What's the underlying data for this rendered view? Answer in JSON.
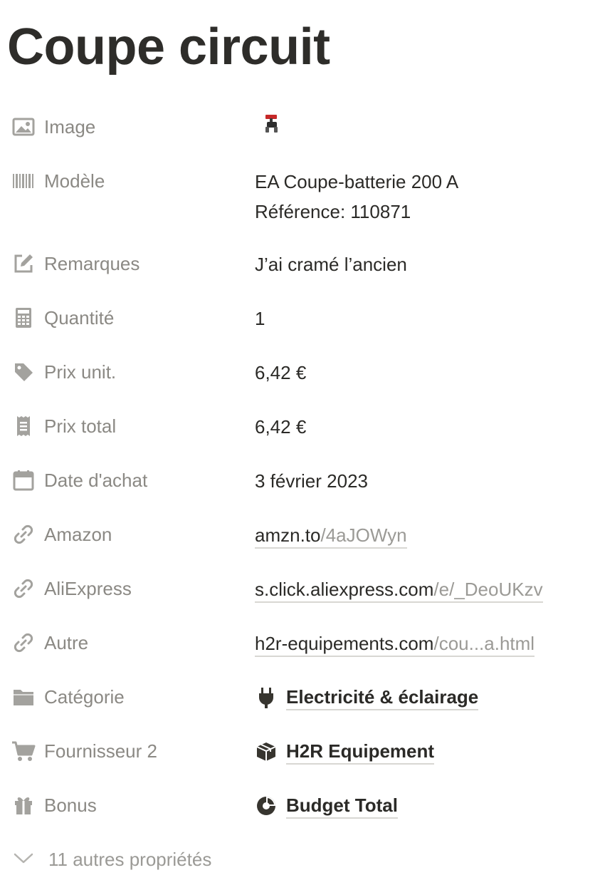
{
  "page": {
    "title": "Coupe circuit"
  },
  "properties": {
    "image": {
      "label": "Image",
      "icon": "image-icon",
      "thumbnail": "red-battery-switch"
    },
    "modele": {
      "label": "Modèle",
      "icon": "barcode-icon",
      "line1": "EA Coupe-batterie 200 A",
      "line2": "Référence: 110871"
    },
    "remarques": {
      "label": "Remarques",
      "icon": "edit-icon",
      "value": "J’ai cramé l’ancien"
    },
    "quantite": {
      "label": "Quantité",
      "icon": "calculator-icon",
      "value": "1"
    },
    "prix_unit": {
      "label": "Prix unit.",
      "icon": "tag-icon",
      "value": "6,42 €"
    },
    "prix_total": {
      "label": "Prix total",
      "icon": "receipt-icon",
      "value": "6,42 €"
    },
    "date_achat": {
      "label": "Date d'achat",
      "icon": "calendar-icon",
      "value": "3 février 2023"
    },
    "amazon": {
      "label": "Amazon",
      "icon": "link-icon",
      "domain": "amzn.to",
      "path": "/4aJOWyn"
    },
    "aliexpress": {
      "label": "AliExpress",
      "icon": "link-icon",
      "domain": "s.click.aliexpress.com",
      "path": "/e/_DeoUKzv"
    },
    "autre": {
      "label": "Autre",
      "icon": "link-icon",
      "domain": "h2r-equipements.com",
      "path": "/cou...a.html"
    },
    "categorie": {
      "label": "Catégorie",
      "icon": "folder-icon",
      "value": "Electricité & éclairage",
      "value_icon": "plug-icon"
    },
    "fournisseur": {
      "label": "Fournisseur 2",
      "icon": "cart-icon",
      "value": "H2R Equipement",
      "value_icon": "package-icon"
    },
    "bonus": {
      "label": "Bonus",
      "icon": "gift-icon",
      "value": "Budget Total",
      "value_icon": "pie-chart-icon"
    }
  },
  "more_properties": {
    "label": "11 autres propriétés",
    "icon": "chevron-down-icon"
  },
  "colors": {
    "label_text": "#8b8984",
    "value_text": "#2b2a27",
    "link_dim": "#9b9a96",
    "icon_gray": "#a3a29e"
  }
}
